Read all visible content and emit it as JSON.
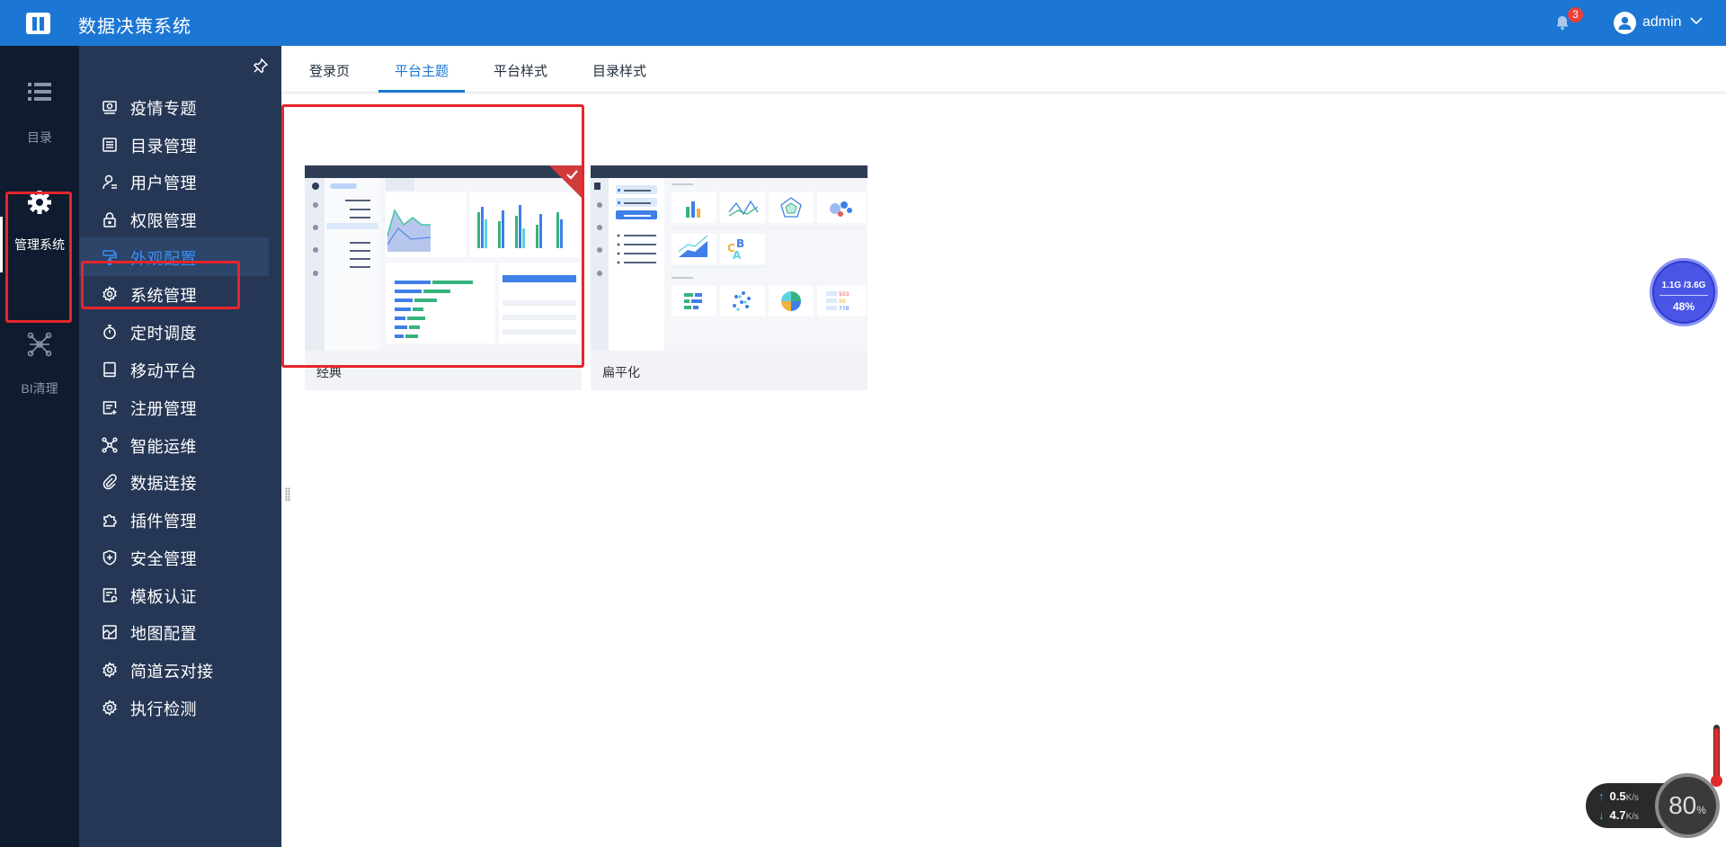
{
  "app": {
    "title": "数据决策系统"
  },
  "topbar": {
    "notification_count": "3",
    "user": "admin"
  },
  "rail": {
    "items": [
      {
        "label": "目录",
        "icon": "list-icon"
      },
      {
        "label": "管理系统",
        "icon": "gear-icon"
      },
      {
        "label": "BI清理",
        "icon": "network-icon"
      }
    ]
  },
  "menu": {
    "items": [
      {
        "label": "疫情专题",
        "icon": "monitor-icon"
      },
      {
        "label": "目录管理",
        "icon": "list-box-icon"
      },
      {
        "label": "用户管理",
        "icon": "user-icon"
      },
      {
        "label": "权限管理",
        "icon": "lock-icon"
      },
      {
        "label": "外观配置",
        "icon": "paint-roller-icon",
        "active": true
      },
      {
        "label": "系统管理",
        "icon": "cog-icon"
      },
      {
        "label": "定时调度",
        "icon": "stopwatch-icon"
      },
      {
        "label": "移动平台",
        "icon": "tablet-icon"
      },
      {
        "label": "注册管理",
        "icon": "register-icon"
      },
      {
        "label": "智能运维",
        "icon": "nodes-icon"
      },
      {
        "label": "数据连接",
        "icon": "paperclip-icon"
      },
      {
        "label": "插件管理",
        "icon": "puzzle-icon"
      },
      {
        "label": "安全管理",
        "icon": "shield-icon"
      },
      {
        "label": "模板认证",
        "icon": "certificate-icon"
      },
      {
        "label": "地图配置",
        "icon": "map-icon"
      },
      {
        "label": "简道云对接",
        "icon": "cloud-link-icon"
      },
      {
        "label": "执行检测",
        "icon": "check-icon"
      }
    ]
  },
  "tabs": [
    {
      "label": "登录页"
    },
    {
      "label": "平台主题",
      "active": true
    },
    {
      "label": "平台样式"
    },
    {
      "label": "目录样式"
    }
  ],
  "themes": [
    {
      "name": "经典",
      "selected": true
    },
    {
      "name": "扁平化",
      "selected": false
    }
  ],
  "monitor": {
    "memory_usage": "1.1G /3.6G",
    "memory_percent": "48%",
    "upload_speed": "0.5",
    "download_speed": "4.7",
    "speed_unit": "K/s",
    "cpu_value": "80",
    "cpu_unit": "%"
  },
  "colors": {
    "topbar": "#1c76d3",
    "rail": "#0f1b2e",
    "menu": "#263755",
    "accent": "#3a8ef5",
    "highlight": "#e8252b"
  }
}
